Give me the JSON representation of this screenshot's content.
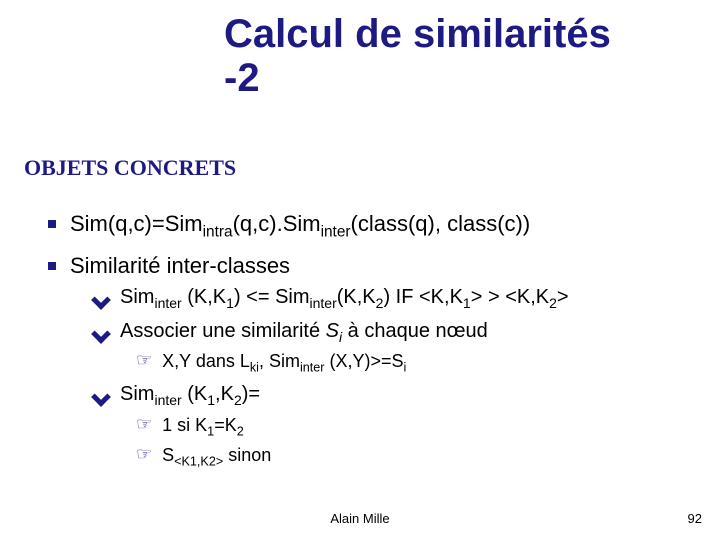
{
  "title_line1": "Calcul de similarités",
  "title_line2": "-2",
  "section_heading": "OBJETS CONCRETS",
  "bullet1_html": "Sim(q,c)=Sim<sub>intra</sub>(q,c).Sim<sub>inter</sub>(class(q), class(c))",
  "bullet2_html": "Similarité inter-classes",
  "sub1_html": "Sim<sub>inter</sub> (K,K<sub>1</sub>) &lt;= Sim<sub>inter</sub>(K,K<sub>2</sub>) IF &lt;K,K<sub>1</sub>&gt; &gt; &lt;K,K<sub>2</sub>&gt;",
  "sub2_html": "Associer une similarité <span class=\"itly\">S<sub>i</sub></span> à chaque nœud",
  "sub2_child_html": "X,Y dans L<sub>ki</sub>, Sim<sub>inter</sub> (X,Y)&gt;=S<sub>i</sub>",
  "sub3_html": "Sim<sub>inter</sub> (K<sub>1</sub>,K<sub>2</sub>)=",
  "sub3_child1_html": "1 si K<sub>1</sub>=K<sub>2</sub>",
  "sub3_child2_html": "S<sub>&lt;K1,K2&gt;</sub> sinon",
  "footer_author": "Alain Mille",
  "footer_page": "92"
}
